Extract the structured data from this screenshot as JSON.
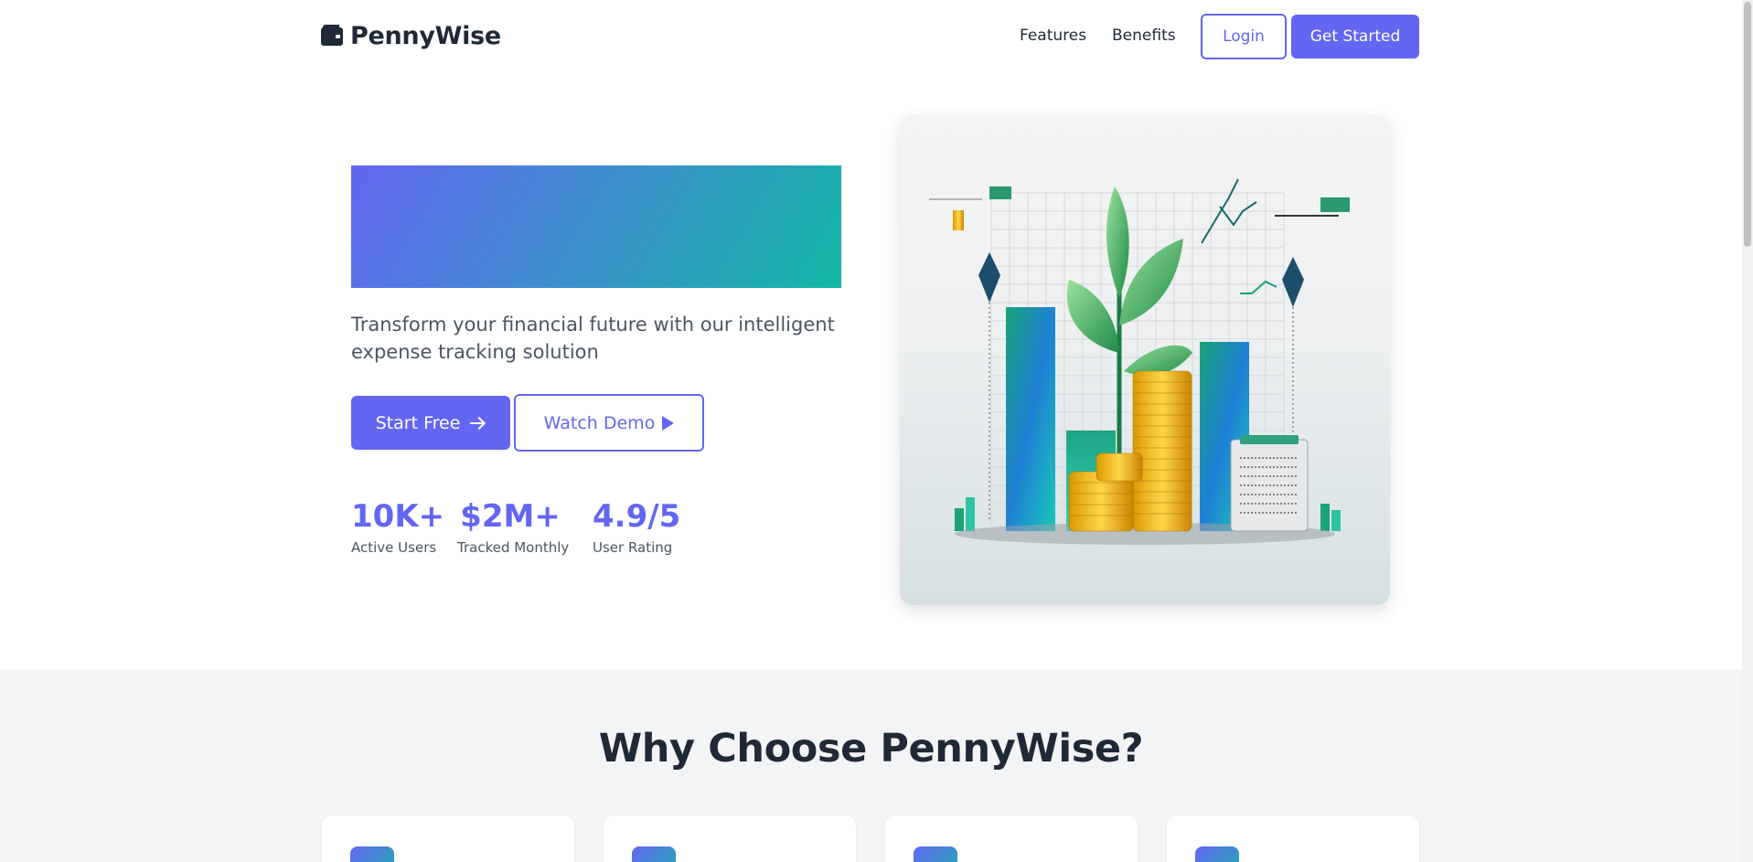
{
  "brand": {
    "name": "PennyWise",
    "icon": "wallet-icon"
  },
  "nav": {
    "links": [
      "Features",
      "Benefits"
    ],
    "login_label": "Login",
    "get_started_label": "Get Started"
  },
  "hero": {
    "subtitle": "Transform your financial future with our intelligent expense tracking solution",
    "start_label": "Start Free",
    "demo_label": "Watch Demo",
    "stats": [
      {
        "value": "10K+",
        "label": "Active Users"
      },
      {
        "value": "$2M+",
        "label": "Tracked Monthly"
      },
      {
        "value": "4.9/5",
        "label": "User Rating"
      }
    ]
  },
  "features": {
    "title": "Why Choose PennyWise?"
  },
  "colors": {
    "primary": "#6366f1",
    "accent": "#14b8a6",
    "text": "#1f2937",
    "muted": "#4b5563",
    "section_bg": "#f3f4f6"
  }
}
